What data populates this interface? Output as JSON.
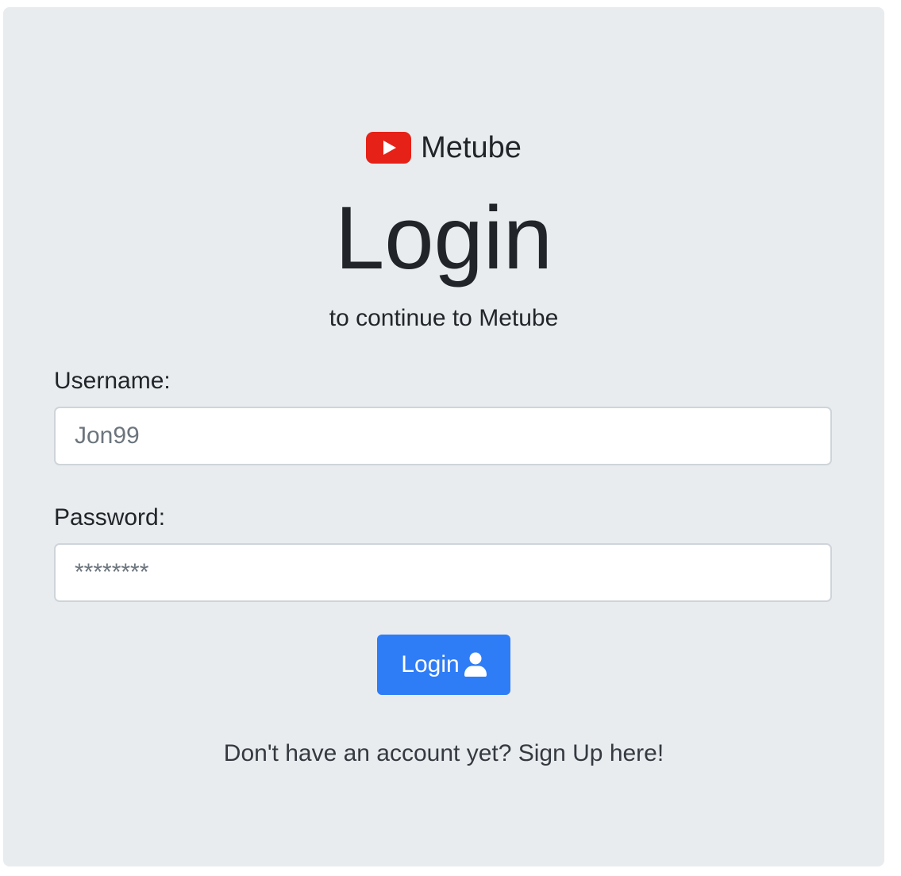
{
  "brand": {
    "name": "Metube",
    "logo_icon": "youtube-play-icon",
    "logo_color": "#e62117"
  },
  "page": {
    "title": "Login",
    "subtitle": "to continue to Metube"
  },
  "form": {
    "username_label": "Username:",
    "username_placeholder": "Jon99",
    "password_label": "Password:",
    "password_placeholder": "********",
    "submit_label": "Login",
    "submit_icon": "user-icon",
    "submit_color": "#2f7df6"
  },
  "footer": {
    "signup_text": "Don't have an account yet? Sign Up here!"
  },
  "colors": {
    "card_background": "#e9ecef"
  }
}
